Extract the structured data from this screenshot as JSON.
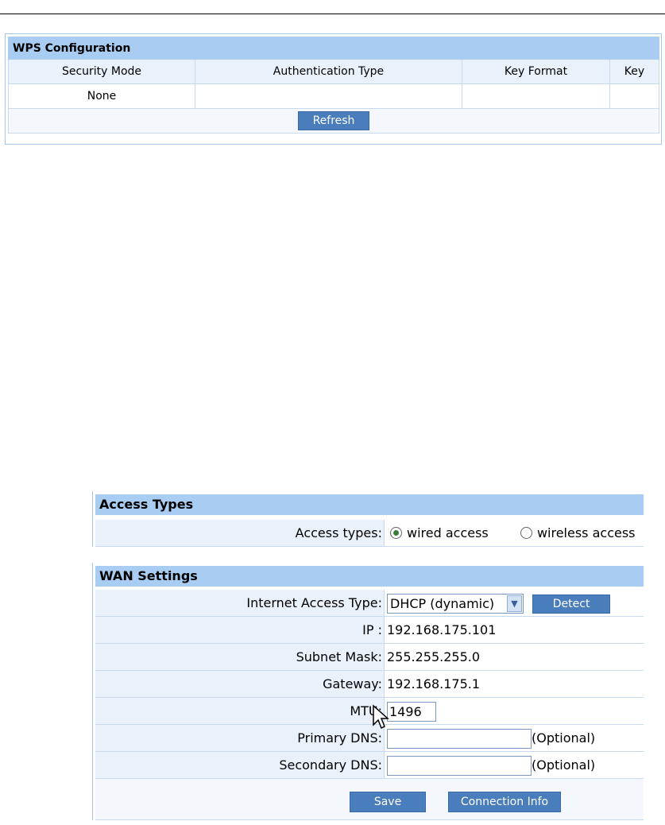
{
  "wps": {
    "title": "WPS Configuration",
    "columns": [
      "Security Mode",
      "Authentication Type",
      "Key Format",
      "Key"
    ],
    "row": [
      "None",
      "",
      "",
      ""
    ],
    "refresh_label": "Refresh"
  },
  "access": {
    "title": "Access Types",
    "label": "Access types:",
    "options": [
      {
        "label": "wired access",
        "selected": true
      },
      {
        "label": "wireless access",
        "selected": false
      }
    ]
  },
  "wan": {
    "title": "WAN Settings",
    "internet_access_label": "Internet Access Type:",
    "internet_access_value": "DHCP (dynamic)",
    "detect_label": "Detect",
    "ip_label": "IP :",
    "ip_value": "192.168.175.101",
    "subnet_label": "Subnet Mask:",
    "subnet_value": "255.255.255.0",
    "gateway_label": "Gateway:",
    "gateway_value": "192.168.175.1",
    "mtu_label": "MTU:",
    "mtu_value": "1496",
    "primary_dns_label": "Primary DNS:",
    "primary_dns_value": "",
    "secondary_dns_label": "Secondary DNS:",
    "secondary_dns_value": "",
    "optional_text": "(Optional)",
    "save_label": "Save",
    "connection_info_label": "Connection Info"
  },
  "colors": {
    "header_bar": "#a9cdf2",
    "label_bg": "#e9f2fb",
    "button_bg": "#4a7dbb"
  }
}
